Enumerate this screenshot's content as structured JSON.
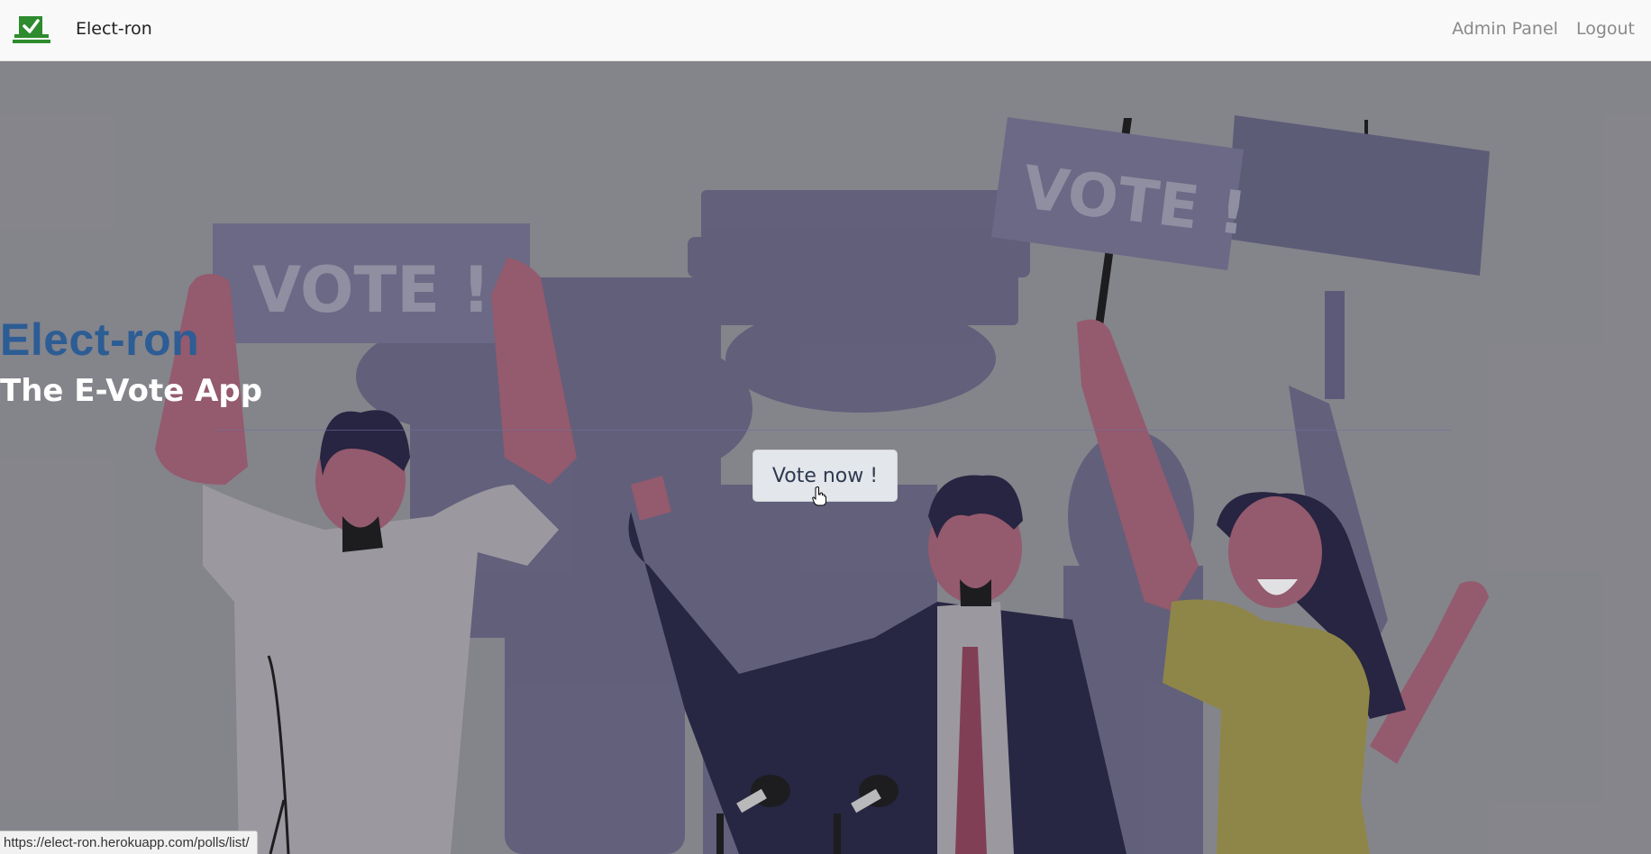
{
  "navbar": {
    "brand_name": "Elect-ron",
    "links": {
      "admin_panel": "Admin Panel",
      "logout": "Logout"
    },
    "logo_icon": "ballot-box-check-icon",
    "logo_color": "#2e8b2e"
  },
  "hero": {
    "title": "Elect-ron",
    "subtitle": "The E-Vote App",
    "cta_label": "Vote now !",
    "sign_text_left": "VOTE !",
    "sign_text_right": "VOTE !",
    "colors": {
      "title": "#2c5d94",
      "subtitle": "#ffffff",
      "button_bg": "#e3e6ea"
    }
  },
  "status_bar": {
    "url": "https://elect-ron.herokuapp.com/polls/list/"
  }
}
